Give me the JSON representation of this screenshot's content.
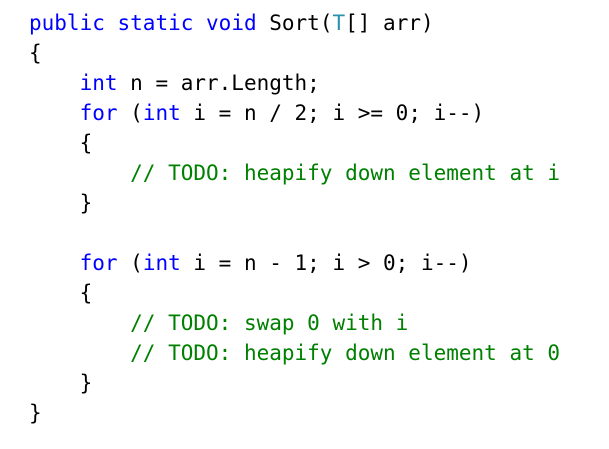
{
  "editor": {
    "colors": {
      "keyword": "#0000ff",
      "type": "#2b91af",
      "plain": "#000000",
      "comment": "#008000",
      "background": "#ffffff"
    },
    "lines": [
      {
        "indent": "",
        "tokens": [
          {
            "kind": "keyword",
            "text": "public"
          },
          {
            "kind": "plain",
            "text": " "
          },
          {
            "kind": "keyword",
            "text": "static"
          },
          {
            "kind": "plain",
            "text": " "
          },
          {
            "kind": "keyword",
            "text": "void"
          },
          {
            "kind": "plain",
            "text": " Sort("
          },
          {
            "kind": "type",
            "text": "T"
          },
          {
            "kind": "plain",
            "text": "[] arr)"
          }
        ]
      },
      {
        "indent": "",
        "tokens": [
          {
            "kind": "plain",
            "text": "{"
          }
        ]
      },
      {
        "indent": "    ",
        "tokens": [
          {
            "kind": "keyword",
            "text": "int"
          },
          {
            "kind": "plain",
            "text": " n = arr.Length;"
          }
        ]
      },
      {
        "indent": "    ",
        "tokens": [
          {
            "kind": "keyword",
            "text": "for"
          },
          {
            "kind": "plain",
            "text": " ("
          },
          {
            "kind": "keyword",
            "text": "int"
          },
          {
            "kind": "plain",
            "text": " i = n / 2; i >= 0; i--)"
          }
        ]
      },
      {
        "indent": "    ",
        "tokens": [
          {
            "kind": "plain",
            "text": "{"
          }
        ]
      },
      {
        "indent": "        ",
        "tokens": [
          {
            "kind": "comment",
            "text": "// TODO: heapify down element at i"
          }
        ]
      },
      {
        "indent": "    ",
        "tokens": [
          {
            "kind": "plain",
            "text": "}"
          }
        ]
      },
      {
        "indent": "",
        "tokens": []
      },
      {
        "indent": "    ",
        "tokens": [
          {
            "kind": "keyword",
            "text": "for"
          },
          {
            "kind": "plain",
            "text": " ("
          },
          {
            "kind": "keyword",
            "text": "int"
          },
          {
            "kind": "plain",
            "text": " i = n - 1; i > 0; i--)"
          }
        ]
      },
      {
        "indent": "    ",
        "tokens": [
          {
            "kind": "plain",
            "text": "{"
          }
        ]
      },
      {
        "indent": "        ",
        "tokens": [
          {
            "kind": "comment",
            "text": "// TODO: swap 0 with i"
          }
        ]
      },
      {
        "indent": "        ",
        "tokens": [
          {
            "kind": "comment",
            "text": "// TODO: heapify down element at 0"
          }
        ]
      },
      {
        "indent": "    ",
        "tokens": [
          {
            "kind": "plain",
            "text": "}"
          }
        ]
      },
      {
        "indent": "",
        "tokens": [
          {
            "kind": "plain",
            "text": "}"
          }
        ]
      }
    ]
  }
}
